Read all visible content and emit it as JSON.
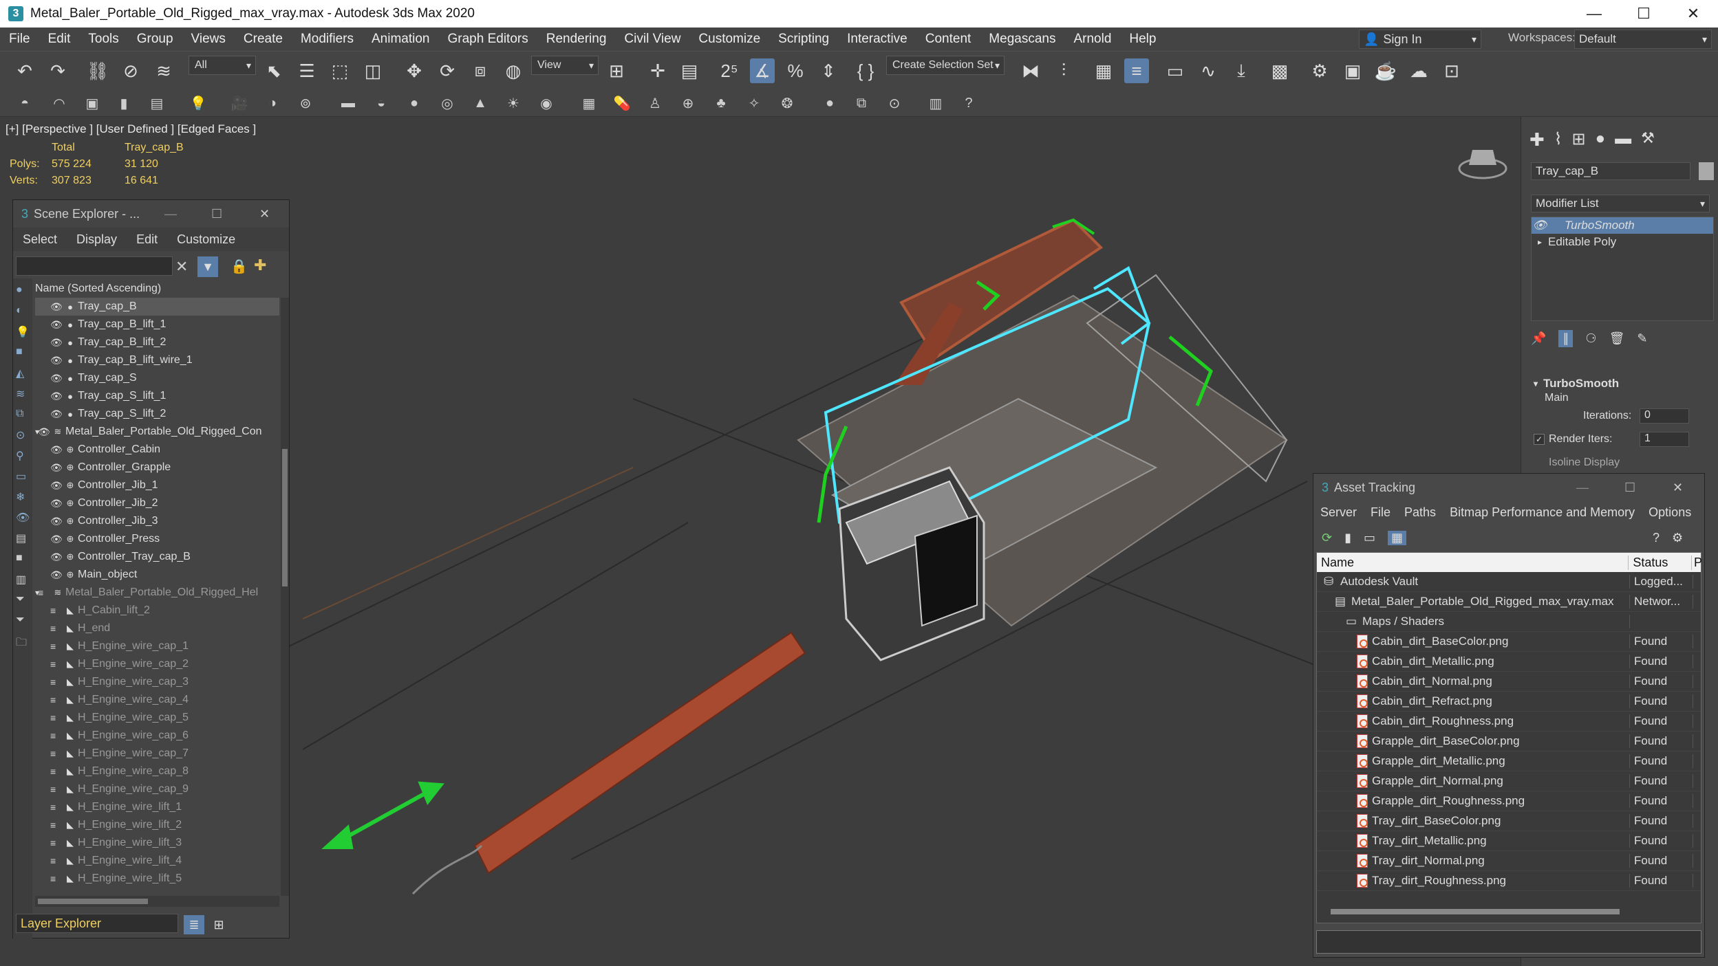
{
  "window": {
    "title": "Metal_Baler_Portable_Old_Rigged_max_vray.max - Autodesk 3ds Max 2020",
    "app_icon": "3"
  },
  "menu": [
    "File",
    "Edit",
    "Tools",
    "Group",
    "Views",
    "Create",
    "Modifiers",
    "Animation",
    "Graph Editors",
    "Rendering",
    "Civil View",
    "Customize",
    "Scripting",
    "Interactive",
    "Content",
    "Megascans",
    "Arnold",
    "Help"
  ],
  "signin": {
    "label": "Sign In"
  },
  "workspaces": {
    "label": "Workspaces:",
    "value": "Default"
  },
  "toolbar": {
    "filter_value": "All",
    "view_value": "View",
    "selection_set_value": "Create Selection Set"
  },
  "viewport": {
    "label": "[+] [Perspective ] [User Defined ] [Edged Faces ]",
    "stats": {
      "header_total": "Total",
      "header_object": "Tray_cap_B",
      "polys_label": "Polys:",
      "polys_total": "575 224",
      "polys_object": "31 120",
      "verts_label": "Verts:",
      "verts_total": "307 823",
      "verts_object": "16 641"
    }
  },
  "scene_explorer": {
    "title": "Scene Explorer - ...",
    "menu": [
      "Select",
      "Display",
      "Edit",
      "Customize"
    ],
    "column_header": "Name (Sorted Ascending)",
    "items": [
      {
        "label": "Tray_cap_B",
        "selected": true
      },
      {
        "label": "Tray_cap_B_lift_1"
      },
      {
        "label": "Tray_cap_B_lift_2"
      },
      {
        "label": "Tray_cap_B_lift_wire_1"
      },
      {
        "label": "Tray_cap_S"
      },
      {
        "label": "Tray_cap_S_lift_1"
      },
      {
        "label": "Tray_cap_S_lift_2"
      },
      {
        "label": "Metal_Baler_Portable_Old_Rigged_Con"
      },
      {
        "label": "Controller_Cabin"
      },
      {
        "label": "Controller_Grapple"
      },
      {
        "label": "Controller_Jib_1"
      },
      {
        "label": "Controller_Jib_2"
      },
      {
        "label": "Controller_Jib_3"
      },
      {
        "label": "Controller_Press"
      },
      {
        "label": "Controller_Tray_cap_B"
      },
      {
        "label": "Main_object"
      },
      {
        "label": "Metal_Baler_Portable_Old_Rigged_Hel"
      },
      {
        "label": "H_Cabin_lift_2"
      },
      {
        "label": "H_end"
      },
      {
        "label": "H_Engine_wire_cap_1"
      },
      {
        "label": "H_Engine_wire_cap_2"
      },
      {
        "label": "H_Engine_wire_cap_3"
      },
      {
        "label": "H_Engine_wire_cap_4"
      },
      {
        "label": "H_Engine_wire_cap_5"
      },
      {
        "label": "H_Engine_wire_cap_6"
      },
      {
        "label": "H_Engine_wire_cap_7"
      },
      {
        "label": "H_Engine_wire_cap_8"
      },
      {
        "label": "H_Engine_wire_cap_9"
      },
      {
        "label": "H_Engine_wire_lift_1"
      },
      {
        "label": "H_Engine_wire_lift_2"
      },
      {
        "label": "H_Engine_wire_lift_3"
      },
      {
        "label": "H_Engine_wire_lift_4"
      },
      {
        "label": "H_Engine_wire_lift_5"
      }
    ],
    "footer": "Layer Explorer"
  },
  "command_panel": {
    "object_name": "Tray_cap_B",
    "modifier_list_label": "Modifier List",
    "stack": [
      "TurboSmooth",
      "Editable Poly"
    ],
    "rollout_title": "TurboSmooth",
    "section": "Main",
    "iterations_label": "Iterations:",
    "iterations_value": "0",
    "render_iters_label": "Render Iters:",
    "render_iters_value": "1",
    "isoline_label": "Isoline Display"
  },
  "asset_tracking": {
    "title": "Asset Tracking",
    "menu": [
      "Server",
      "File",
      "Paths",
      "Bitmap Performance and Memory",
      "Options"
    ],
    "col_name": "Name",
    "col_status": "Status",
    "col_extra": "P",
    "rows": [
      {
        "name": "Autodesk Vault",
        "status": "Logged...",
        "level": 0
      },
      {
        "name": "Metal_Baler_Portable_Old_Rigged_max_vray.max",
        "status": "Networ...",
        "level": 1
      },
      {
        "name": "Maps / Shaders",
        "status": "",
        "level": 2
      },
      {
        "name": "Cabin_dirt_BaseColor.png",
        "status": "Found",
        "level": 3
      },
      {
        "name": "Cabin_dirt_Metallic.png",
        "status": "Found",
        "level": 3
      },
      {
        "name": "Cabin_dirt_Normal.png",
        "status": "Found",
        "level": 3
      },
      {
        "name": "Cabin_dirt_Refract.png",
        "status": "Found",
        "level": 3
      },
      {
        "name": "Cabin_dirt_Roughness.png",
        "status": "Found",
        "level": 3
      },
      {
        "name": "Grapple_dirt_BaseColor.png",
        "status": "Found",
        "level": 3
      },
      {
        "name": "Grapple_dirt_Metallic.png",
        "status": "Found",
        "level": 3
      },
      {
        "name": "Grapple_dirt_Normal.png",
        "status": "Found",
        "level": 3
      },
      {
        "name": "Grapple_dirt_Roughness.png",
        "status": "Found",
        "level": 3
      },
      {
        "name": "Tray_dirt_BaseColor.png",
        "status": "Found",
        "level": 3
      },
      {
        "name": "Tray_dirt_Metallic.png",
        "status": "Found",
        "level": 3
      },
      {
        "name": "Tray_dirt_Normal.png",
        "status": "Found",
        "level": 3
      },
      {
        "name": "Tray_dirt_Roughness.png",
        "status": "Found",
        "level": 3
      }
    ]
  }
}
